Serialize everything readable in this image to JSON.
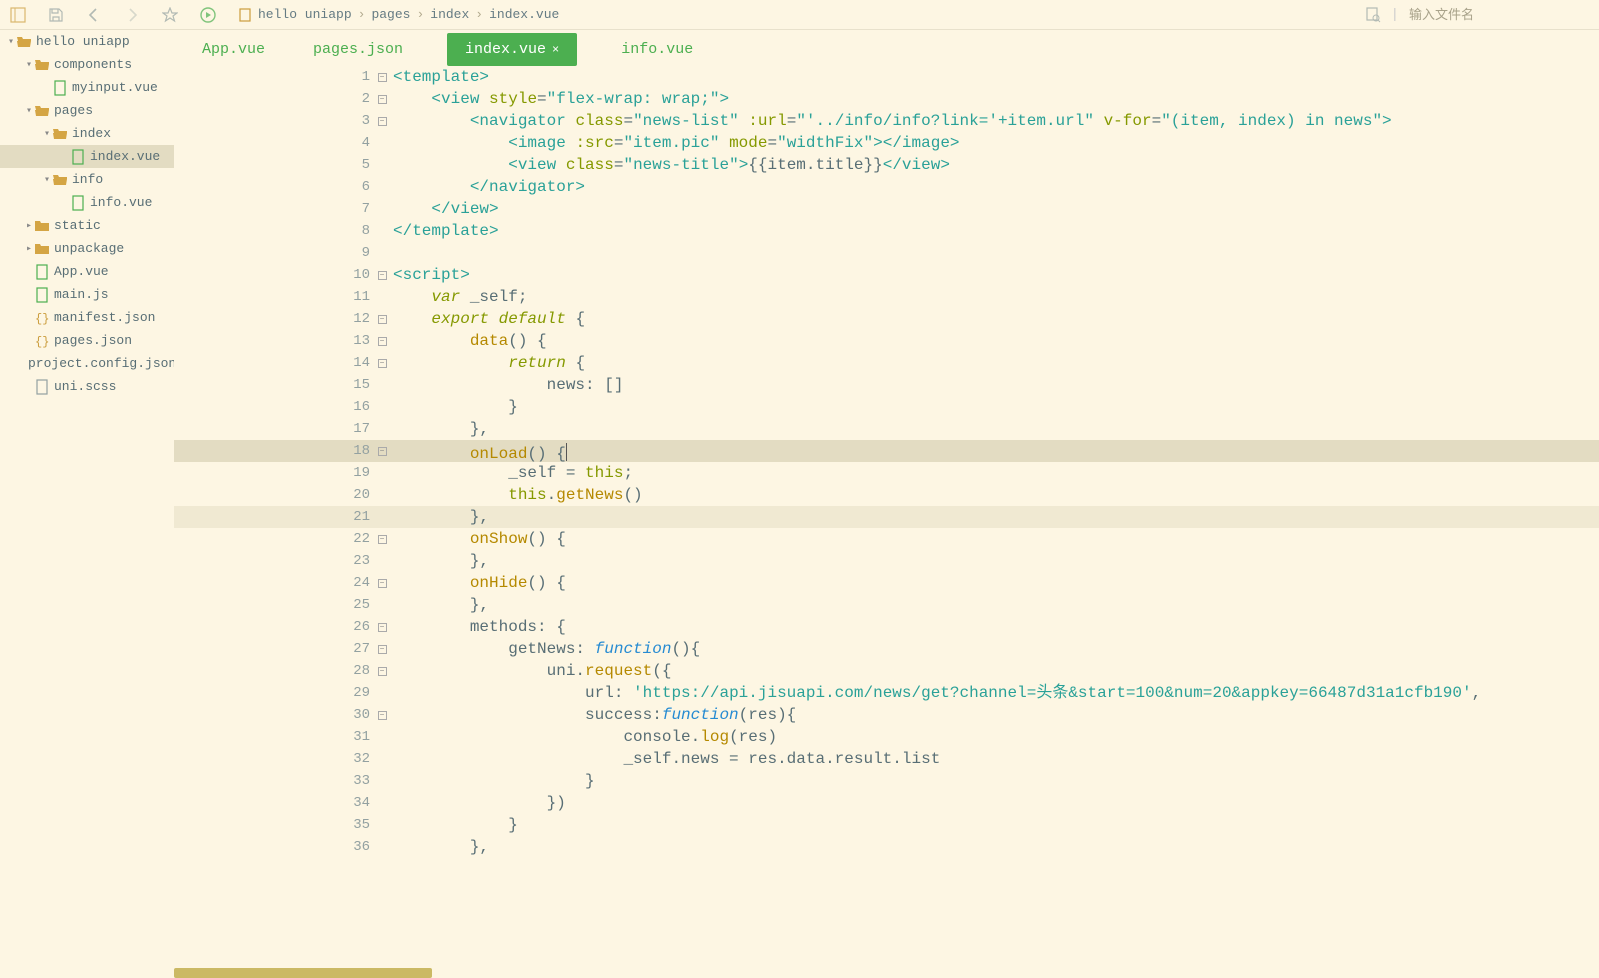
{
  "toolbar": {
    "search_placeholder": "输入文件名"
  },
  "breadcrumb": [
    "hello uniapp",
    "pages",
    "index",
    "index.vue"
  ],
  "sidebar": {
    "root": "hello uniapp",
    "items": [
      {
        "label": "components",
        "type": "folder-open",
        "depth": 1,
        "expanded": true
      },
      {
        "label": "myinput.vue",
        "type": "file-green",
        "depth": 2
      },
      {
        "label": "pages",
        "type": "folder-open",
        "depth": 1,
        "expanded": true
      },
      {
        "label": "index",
        "type": "folder-open",
        "depth": 2,
        "expanded": true
      },
      {
        "label": "index.vue",
        "type": "file-green",
        "depth": 3,
        "selected": true
      },
      {
        "label": "info",
        "type": "folder-open",
        "depth": 2,
        "expanded": true
      },
      {
        "label": "info.vue",
        "type": "file-green",
        "depth": 3
      },
      {
        "label": "static",
        "type": "folder",
        "depth": 1,
        "expanded": false
      },
      {
        "label": "unpackage",
        "type": "folder",
        "depth": 1,
        "expanded": false
      },
      {
        "label": "App.vue",
        "type": "file-green",
        "depth": 1
      },
      {
        "label": "main.js",
        "type": "file-green",
        "depth": 1
      },
      {
        "label": "manifest.json",
        "type": "file-orange",
        "depth": 1
      },
      {
        "label": "pages.json",
        "type": "file-orange",
        "depth": 1
      },
      {
        "label": "project.config.json",
        "type": "file-orange",
        "depth": 1
      },
      {
        "label": "uni.scss",
        "type": "file-gray",
        "depth": 1
      }
    ]
  },
  "tabs": [
    {
      "label": "App.vue",
      "active": false
    },
    {
      "label": "pages.json",
      "active": false
    },
    {
      "label": "index.vue",
      "active": true
    },
    {
      "label": "info.vue",
      "active": false
    }
  ],
  "code": {
    "lines": [
      {
        "n": 1,
        "fold": true,
        "html": "<span class='tag'>&lt;template&gt;</span>"
      },
      {
        "n": 2,
        "fold": true,
        "indent": 2,
        "html": "<span class='tag'>&lt;view</span> <span class='attr'>style</span>=<span class='str'>\"flex-wrap: wrap;\"</span><span class='tag'>&gt;</span>"
      },
      {
        "n": 3,
        "fold": true,
        "indent": 4,
        "html": "<span class='tag'>&lt;navigator</span> <span class='attr'>class</span>=<span class='str'>\"news-list\"</span> <span class='attr'>:url</span>=<span class='str'>\"'../info/info?link='+item.url\"</span> <span class='attr'>v-for</span>=<span class='str'>\"(item, index) in news\"</span><span class='tag'>&gt;</span>"
      },
      {
        "n": 4,
        "fold": false,
        "indent": 6,
        "html": "<span class='tag'>&lt;image</span> <span class='attr'>:src</span>=<span class='str'>\"item.pic\"</span> <span class='attr'>mode</span>=<span class='str'>\"widthFix\"</span><span class='tag'>&gt;&lt;/image&gt;</span>"
      },
      {
        "n": 5,
        "fold": false,
        "indent": 6,
        "html": "<span class='tag'>&lt;view</span> <span class='attr'>class</span>=<span class='str'>\"news-title\"</span><span class='tag'>&gt;</span><span class='txt-plain'>{{item.title}}</span><span class='tag'>&lt;/view&gt;</span>"
      },
      {
        "n": 6,
        "fold": false,
        "indent": 4,
        "html": "<span class='tag'>&lt;/navigator&gt;</span>"
      },
      {
        "n": 7,
        "fold": false,
        "indent": 2,
        "html": "<span class='tag'>&lt;/view&gt;</span>"
      },
      {
        "n": 8,
        "fold": false,
        "html": "<span class='tag'>&lt;/template&gt;</span>"
      },
      {
        "n": 9,
        "fold": false,
        "html": ""
      },
      {
        "n": 10,
        "fold": true,
        "html": "<span class='tag'>&lt;script&gt;</span>"
      },
      {
        "n": 11,
        "fold": false,
        "indent": 2,
        "html": "<span class='kw'>var</span> <span class='txt-plain'>_self;</span>"
      },
      {
        "n": 12,
        "fold": true,
        "indent": 2,
        "html": "<span class='kw'>export</span> <span class='kw'>default</span> <span class='txt-plain'>{</span>"
      },
      {
        "n": 13,
        "fold": true,
        "indent": 4,
        "html": "<span class='fn'>data</span><span class='txt-plain'>() {</span>"
      },
      {
        "n": 14,
        "fold": true,
        "indent": 6,
        "html": "<span class='kw'>return</span> <span class='txt-plain'>{</span>"
      },
      {
        "n": 15,
        "fold": false,
        "indent": 8,
        "html": "<span class='txt-plain'>news: []</span>"
      },
      {
        "n": 16,
        "fold": false,
        "indent": 6,
        "html": "<span class='txt-plain'>}</span>"
      },
      {
        "n": 17,
        "fold": false,
        "indent": 4,
        "html": "<span class='txt-plain'>},</span>"
      },
      {
        "n": 18,
        "fold": true,
        "indent": 4,
        "highlight": true,
        "html": "<span class='fn'>onLoad</span><span class='txt-plain'>() {</span><span class='cursor'></span>"
      },
      {
        "n": 19,
        "fold": false,
        "indent": 6,
        "html": "<span class='txt-plain'>_self = </span><span class='this'>this</span><span class='txt-plain'>;</span>"
      },
      {
        "n": 20,
        "fold": false,
        "indent": 6,
        "html": "<span class='this'>this</span><span class='txt-plain'>.</span><span class='fn'>getNews</span><span class='txt-plain'>()</span>"
      },
      {
        "n": 21,
        "fold": false,
        "indent": 4,
        "hlclose": true,
        "html": "<span class='txt-plain'>},</span>"
      },
      {
        "n": 22,
        "fold": true,
        "indent": 4,
        "html": "<span class='fn'>onShow</span><span class='txt-plain'>() {</span>"
      },
      {
        "n": 23,
        "fold": false,
        "indent": 4,
        "html": "<span class='txt-plain'>},</span>"
      },
      {
        "n": 24,
        "fold": true,
        "indent": 4,
        "html": "<span class='fn'>onHide</span><span class='txt-plain'>() {</span>"
      },
      {
        "n": 25,
        "fold": false,
        "indent": 4,
        "html": "<span class='txt-plain'>},</span>"
      },
      {
        "n": 26,
        "fold": true,
        "indent": 4,
        "html": "<span class='txt-plain'>methods: {</span>"
      },
      {
        "n": 27,
        "fold": true,
        "indent": 6,
        "html": "<span class='txt-plain'>getNews: </span><span class='fn-italic'>function</span><span class='txt-plain'>(){</span>"
      },
      {
        "n": 28,
        "fold": true,
        "indent": 8,
        "html": "<span class='txt-plain'>uni.</span><span class='fn'>request</span><span class='txt-plain'>({</span>"
      },
      {
        "n": 29,
        "fold": false,
        "indent": 10,
        "html": "<span class='txt-plain'>url: </span><span class='str'>'https://api.jisuapi.com/news/get?channel=头条&amp;start=100&amp;num=20&amp;appkey=66487d31a1cfb190'</span><span class='txt-plain'>,</span>"
      },
      {
        "n": 30,
        "fold": true,
        "indent": 10,
        "html": "<span class='txt-plain'>success:</span><span class='fn-italic'>function</span><span class='txt-plain'>(res){</span>"
      },
      {
        "n": 31,
        "fold": false,
        "indent": 12,
        "html": "<span class='txt-plain'>console.</span><span class='fn'>log</span><span class='txt-plain'>(res)</span>"
      },
      {
        "n": 32,
        "fold": false,
        "indent": 12,
        "html": "<span class='txt-plain'>_self.news = res.data.result.list</span>"
      },
      {
        "n": 33,
        "fold": false,
        "indent": 10,
        "html": "<span class='txt-plain'>}</span>"
      },
      {
        "n": 34,
        "fold": false,
        "indent": 8,
        "html": "<span class='txt-plain'>})</span>"
      },
      {
        "n": 35,
        "fold": false,
        "indent": 6,
        "html": "<span class='txt-plain'>}</span>"
      },
      {
        "n": 36,
        "fold": false,
        "indent": 4,
        "html": "<span class='txt-plain'>},</span>"
      }
    ]
  }
}
